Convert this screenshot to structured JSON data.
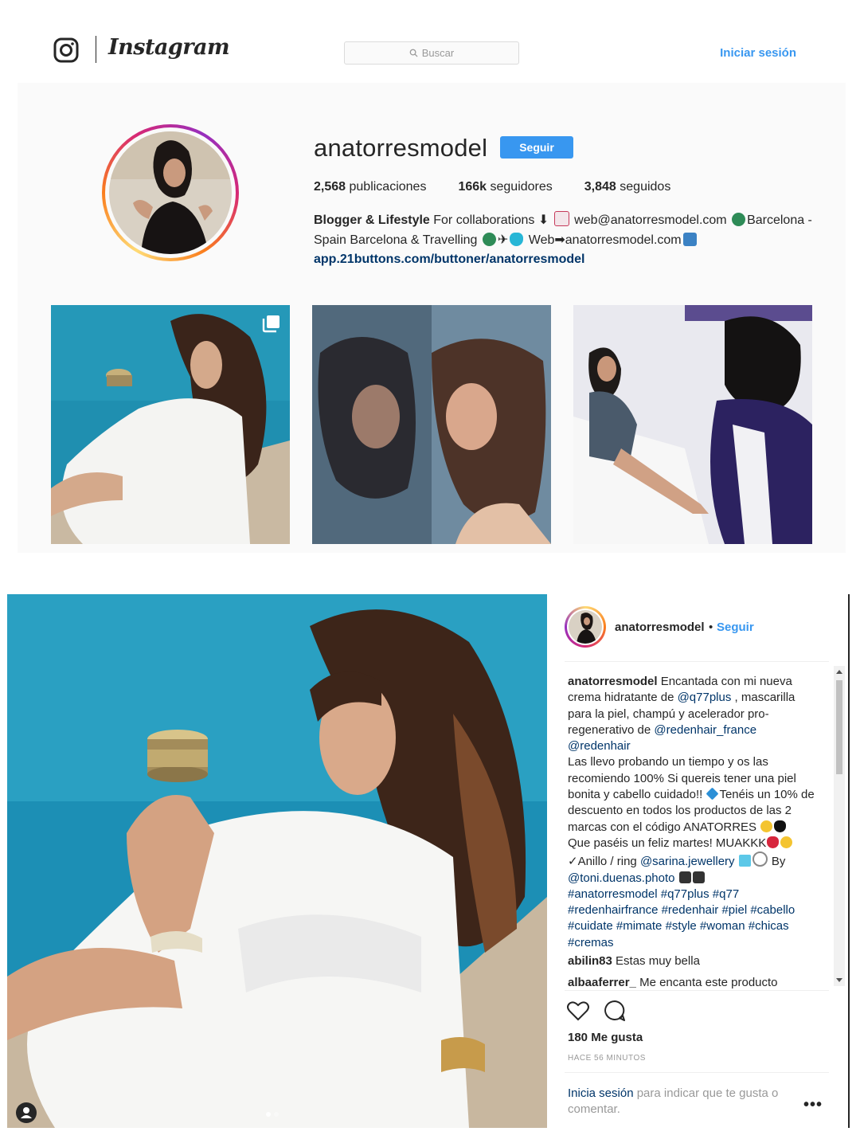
{
  "nav": {
    "logo_text": "Instagram",
    "search_placeholder": "Buscar",
    "login_label": "Iniciar sesión",
    "icons": [
      "instagram-camera-icon",
      "search-icon"
    ]
  },
  "profile": {
    "username": "anatorresmodel",
    "follow_label": "Seguir",
    "stats": [
      {
        "count": "2,568",
        "label": "publicaciones"
      },
      {
        "count": "166k",
        "label": "seguidores"
      },
      {
        "count": "3,848",
        "label": "seguidos"
      }
    ],
    "bio": {
      "name": "Blogger & Lifestyle",
      "line1": " For collaborations ⬇",
      "email": " web@anatorresmodel.com ",
      "loc1": "Barcelona - Spain Barcelona & Travelling ",
      "web_prefix": " Web➡anatorresmodel.com",
      "link": "app.21buttons.com/buttoner/anatorresmodel"
    }
  },
  "grid": {
    "posts": [
      {
        "alt": "woman in white dress holding cream jar by pool",
        "multi": true
      },
      {
        "alt": "woman reflected in glass",
        "multi": false
      },
      {
        "alt": "woman on treatment chair with technician",
        "multi": false
      }
    ]
  },
  "post": {
    "header_user": "anatorresmodel",
    "header_dot": "•",
    "header_follow": "Seguir",
    "caption": {
      "user": "anatorresmodel",
      "t1": " Encantada con mi nueva crema hidratante de ",
      "m1": "@q77plus",
      "t2": " , mascarilla para la piel, champú y acelerador pro-regenerativo de ",
      "m2": "@redenhair_france",
      "m3": "@redenhair",
      "t3": "Las llevo probando un tiempo y os las recomiendo 100% Si quereis tener una piel bonita y cabello cuidado!! ",
      "t4": "Tenéis un 10% de descuento en todos los productos de las 2 marcas con el código ANATORRES ",
      "t5": "Que paséis un feliz martes! MUAKKK",
      "t6": "✓Anillo / ring ",
      "m4": "@sarina.jewellery",
      "t7": " By ",
      "m5": "@toni.duenas.photo",
      "tags": "#anatorresmodel #q77plus #q77 #redenhairfrance #redenhair #piel #cabello #cuidate #mimate #style #woman #chicas #cremas"
    },
    "comments": [
      {
        "user": "abilin83",
        "text": " Estas muy bella"
      },
      {
        "user": "albaaferrer_",
        "text": " Me encanta este producto"
      }
    ],
    "likes": "180 Me gusta",
    "timestamp": "HACE 56 MINUTOS",
    "login_link": "Inicia sesión",
    "login_rest": " para indicar que te gusta o comentar.",
    "more": "•••"
  },
  "colors": {
    "accent": "#3897f0",
    "link": "#003569",
    "text": "#262626",
    "muted": "#999999",
    "bg": "#fafafa"
  }
}
